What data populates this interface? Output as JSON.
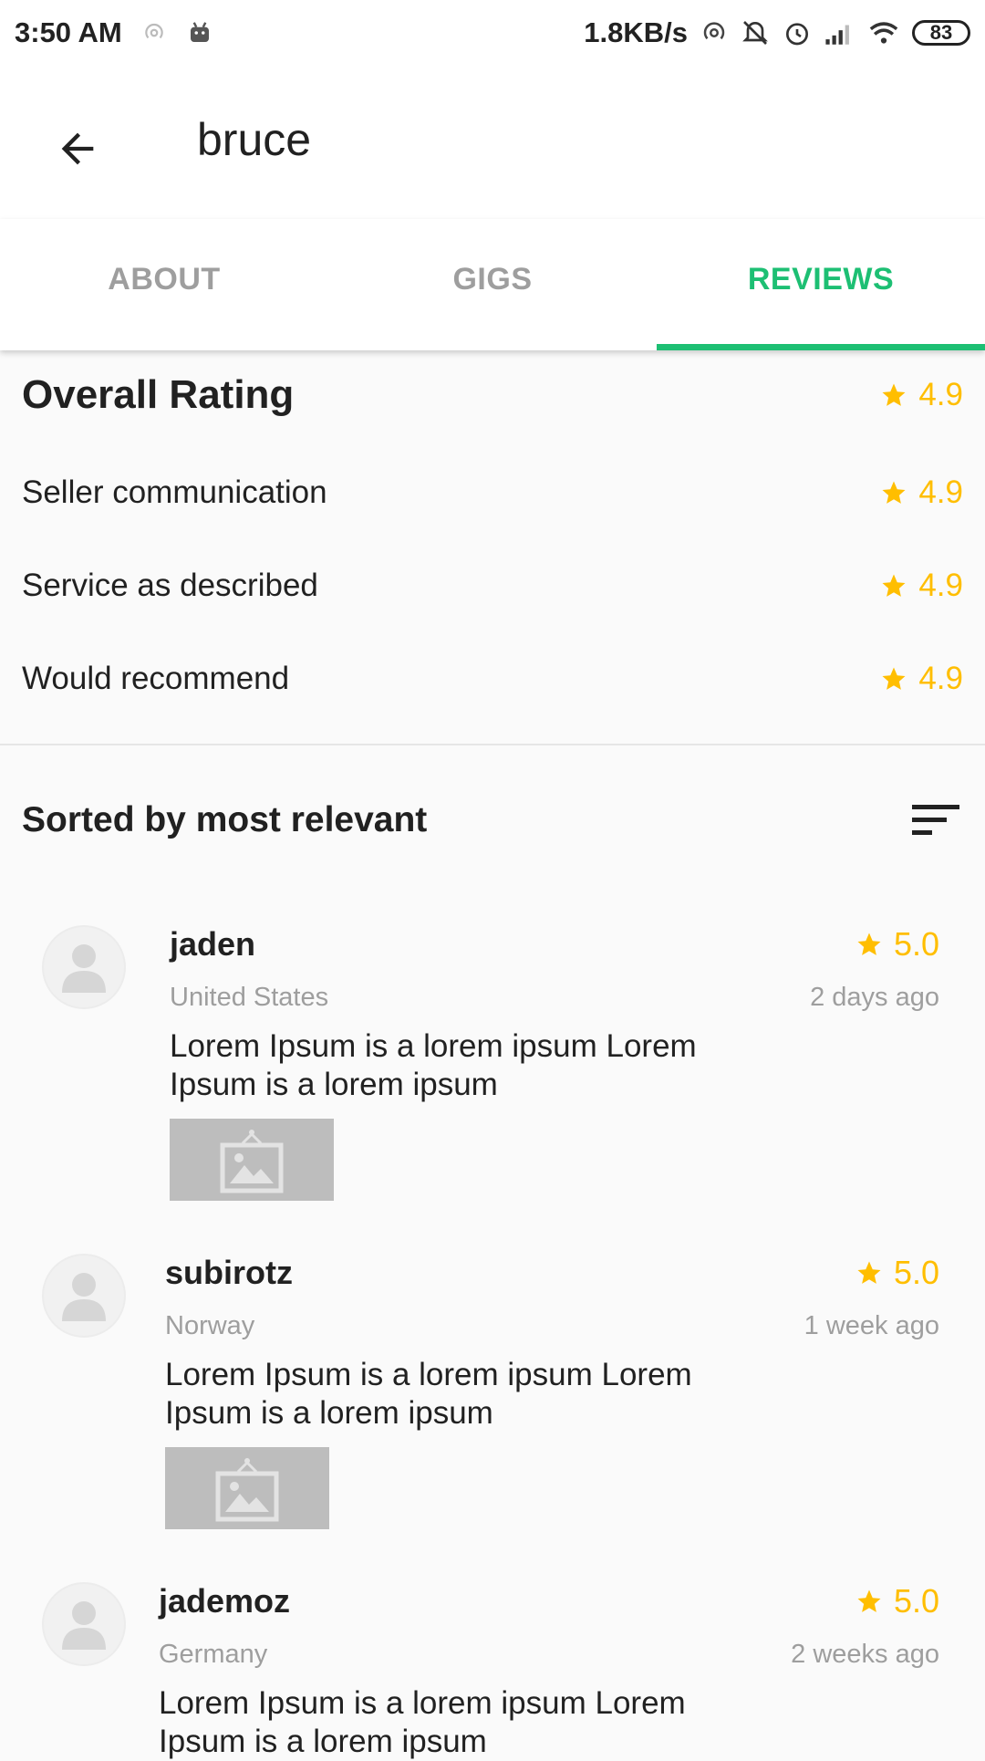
{
  "status_bar": {
    "time": "3:50 AM",
    "network_speed": "1.8KB/s",
    "battery": "83",
    "icons": [
      "hotspot-icon",
      "android-icon",
      "hotspot-icon",
      "mute-icon",
      "alarm-icon",
      "signal-icon",
      "wifi-icon",
      "battery-icon"
    ]
  },
  "appbar": {
    "title": "bruce",
    "back_icon": "arrow-left-icon"
  },
  "tabs": [
    {
      "label": "ABOUT",
      "active": false
    },
    {
      "label": "GIGS",
      "active": false
    },
    {
      "label": "REVIEWS",
      "active": true
    }
  ],
  "ratings": {
    "overall": {
      "label": "Overall Rating",
      "value": "4.9"
    },
    "items": [
      {
        "label": "Seller communication",
        "value": "4.9"
      },
      {
        "label": "Service as described",
        "value": "4.9"
      },
      {
        "label": "Would recommend",
        "value": "4.9"
      }
    ]
  },
  "sort": {
    "label": "Sorted by most relevant",
    "icon": "sort-icon"
  },
  "reviews": [
    {
      "name": "jaden",
      "country": "United States",
      "score": "5.0",
      "time": "2 days ago",
      "text": "Lorem Ipsum is a lorem ipsum Lorem Ipsum is a lorem ipsum"
    },
    {
      "name": "subirotz",
      "country": "Norway",
      "score": "5.0",
      "time": "1 week ago",
      "text": "Lorem Ipsum is a lorem ipsum Lorem Ipsum is a lorem ipsum"
    },
    {
      "name": "jademoz",
      "country": "Germany",
      "score": "5.0",
      "time": "2 weeks ago",
      "text": "Lorem Ipsum is a lorem ipsum Lorem Ipsum is a lorem ipsum"
    }
  ],
  "colors": {
    "accent": "#1dbf73",
    "star": "#ffbe00",
    "muted": "#9e9e9e"
  }
}
